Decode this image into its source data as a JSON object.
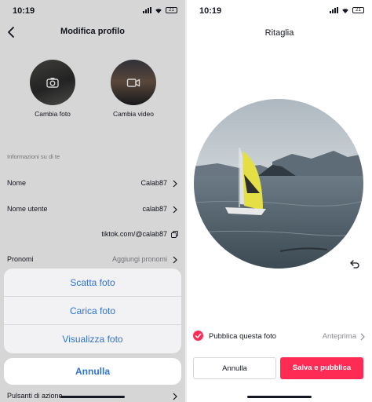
{
  "left": {
    "status": {
      "time": "10:19",
      "battery": "21"
    },
    "header": {
      "title": "Modifica profilo"
    },
    "avatars": [
      {
        "label": "Cambia foto",
        "icon": "camera-icon"
      },
      {
        "label": "Cambia video",
        "icon": "video-camera-icon"
      }
    ],
    "about": {
      "section_title": "Informazioni su di te",
      "rows": [
        {
          "key": "Nome",
          "value": "Calab87"
        },
        {
          "key": "Nome utente",
          "value": "calab87"
        },
        {
          "key": "",
          "value": "tiktok.com/@calab87"
        },
        {
          "key": "Pronomi",
          "value": "Aggiungi pronomi"
        }
      ],
      "bottom_row": "Pulsanti di azione"
    },
    "action_sheet": {
      "items": [
        "Scatta foto",
        "Carica foto",
        "Visualizza foto"
      ],
      "cancel": "Annulla"
    },
    "accent_color": "#2f73d8"
  },
  "right": {
    "status": {
      "time": "10:19",
      "battery": "21"
    },
    "title": "Ritaglia",
    "publish_label": "Pubblica questa foto",
    "publish_checked": true,
    "preview_label": "Anteprima",
    "cancel_label": "Annulla",
    "save_label": "Salva e pubblica",
    "brand_color": "#fe2c55",
    "icons": [
      "undo-icon",
      "checkmark-icon",
      "chevron-right-icon"
    ]
  }
}
